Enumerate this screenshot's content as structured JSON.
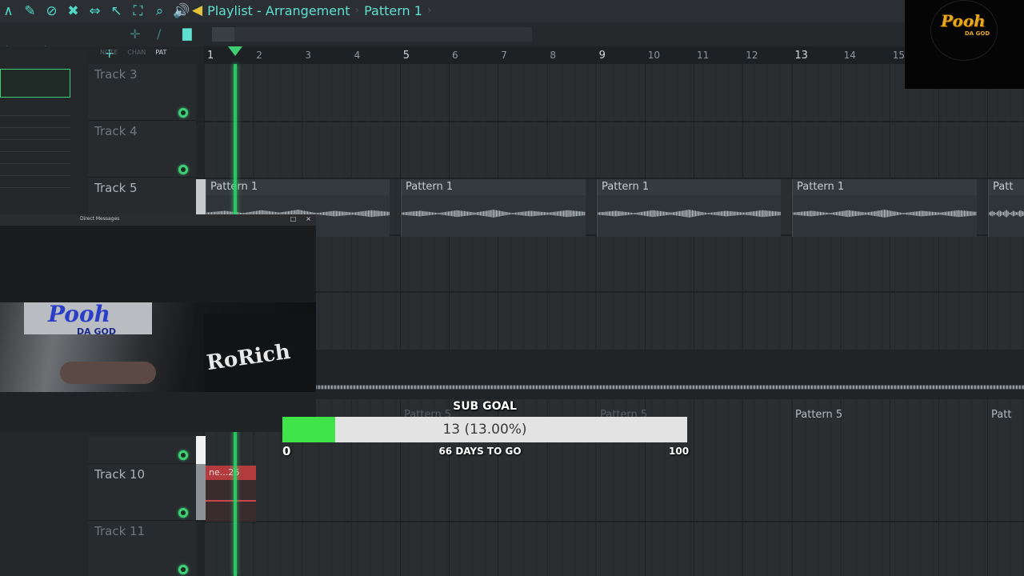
{
  "toolbar": {
    "icons": [
      "magnet-icon",
      "paint-icon",
      "delete-icon",
      "mute-icon",
      "slip-icon",
      "select-icon",
      "zoom-box-icon",
      "zoom-icon",
      "speaker-icon"
    ],
    "title_playlist": "Playlist - Arrangement",
    "title_pattern": "Pattern 1",
    "sep1": "›",
    "sep2": "›"
  },
  "left_panel": {
    "plus": "+",
    "tabs": [
      "NOTE",
      "CHAN",
      "PAT"
    ],
    "active_tab": "PAT"
  },
  "ruler": {
    "numbers": [
      "1",
      "2",
      "3",
      "4",
      "5",
      "6",
      "7",
      "8",
      "9",
      "10",
      "11",
      "12",
      "13",
      "14",
      "15"
    ]
  },
  "tracks": {
    "t3": "Track 3",
    "t4": "Track 4",
    "t5": "Track 5",
    "t10": "Track 10",
    "t11": "Track 11"
  },
  "clips_row5": [
    "Pattern 1",
    "Pattern 1",
    "Pattern 1",
    "Pattern 1",
    "Patt"
  ],
  "clips_lower": [
    "Pattern 5",
    "Pattern 5",
    "Pattern 5",
    "Patt"
  ],
  "red_clip": "ne...26",
  "dm_window": {
    "title": "Direct Messages",
    "btn_min": "□",
    "btn_close": "×"
  },
  "webcam": {
    "sign_main": "Pooh",
    "sign_sub": "DA GOD",
    "shirt_text": "RoRich"
  },
  "sub_goal": {
    "title": "SUB GOAL",
    "current": 13,
    "target": 100,
    "progress_fraction": 0.13,
    "progress_text": "13 (13.00%)",
    "min_label": "0",
    "max_label": "100",
    "days_label": "66 DAYS TO GO"
  },
  "channel_logo": {
    "main": "Pooh",
    "sub": "DA GOD"
  },
  "colors": {
    "accent": "#5fe0cf",
    "playhead": "#2dd46c",
    "goal_fill": "#3ee44a",
    "red_clip": "#b33a3d",
    "logo_gold": "#e6a91c"
  }
}
